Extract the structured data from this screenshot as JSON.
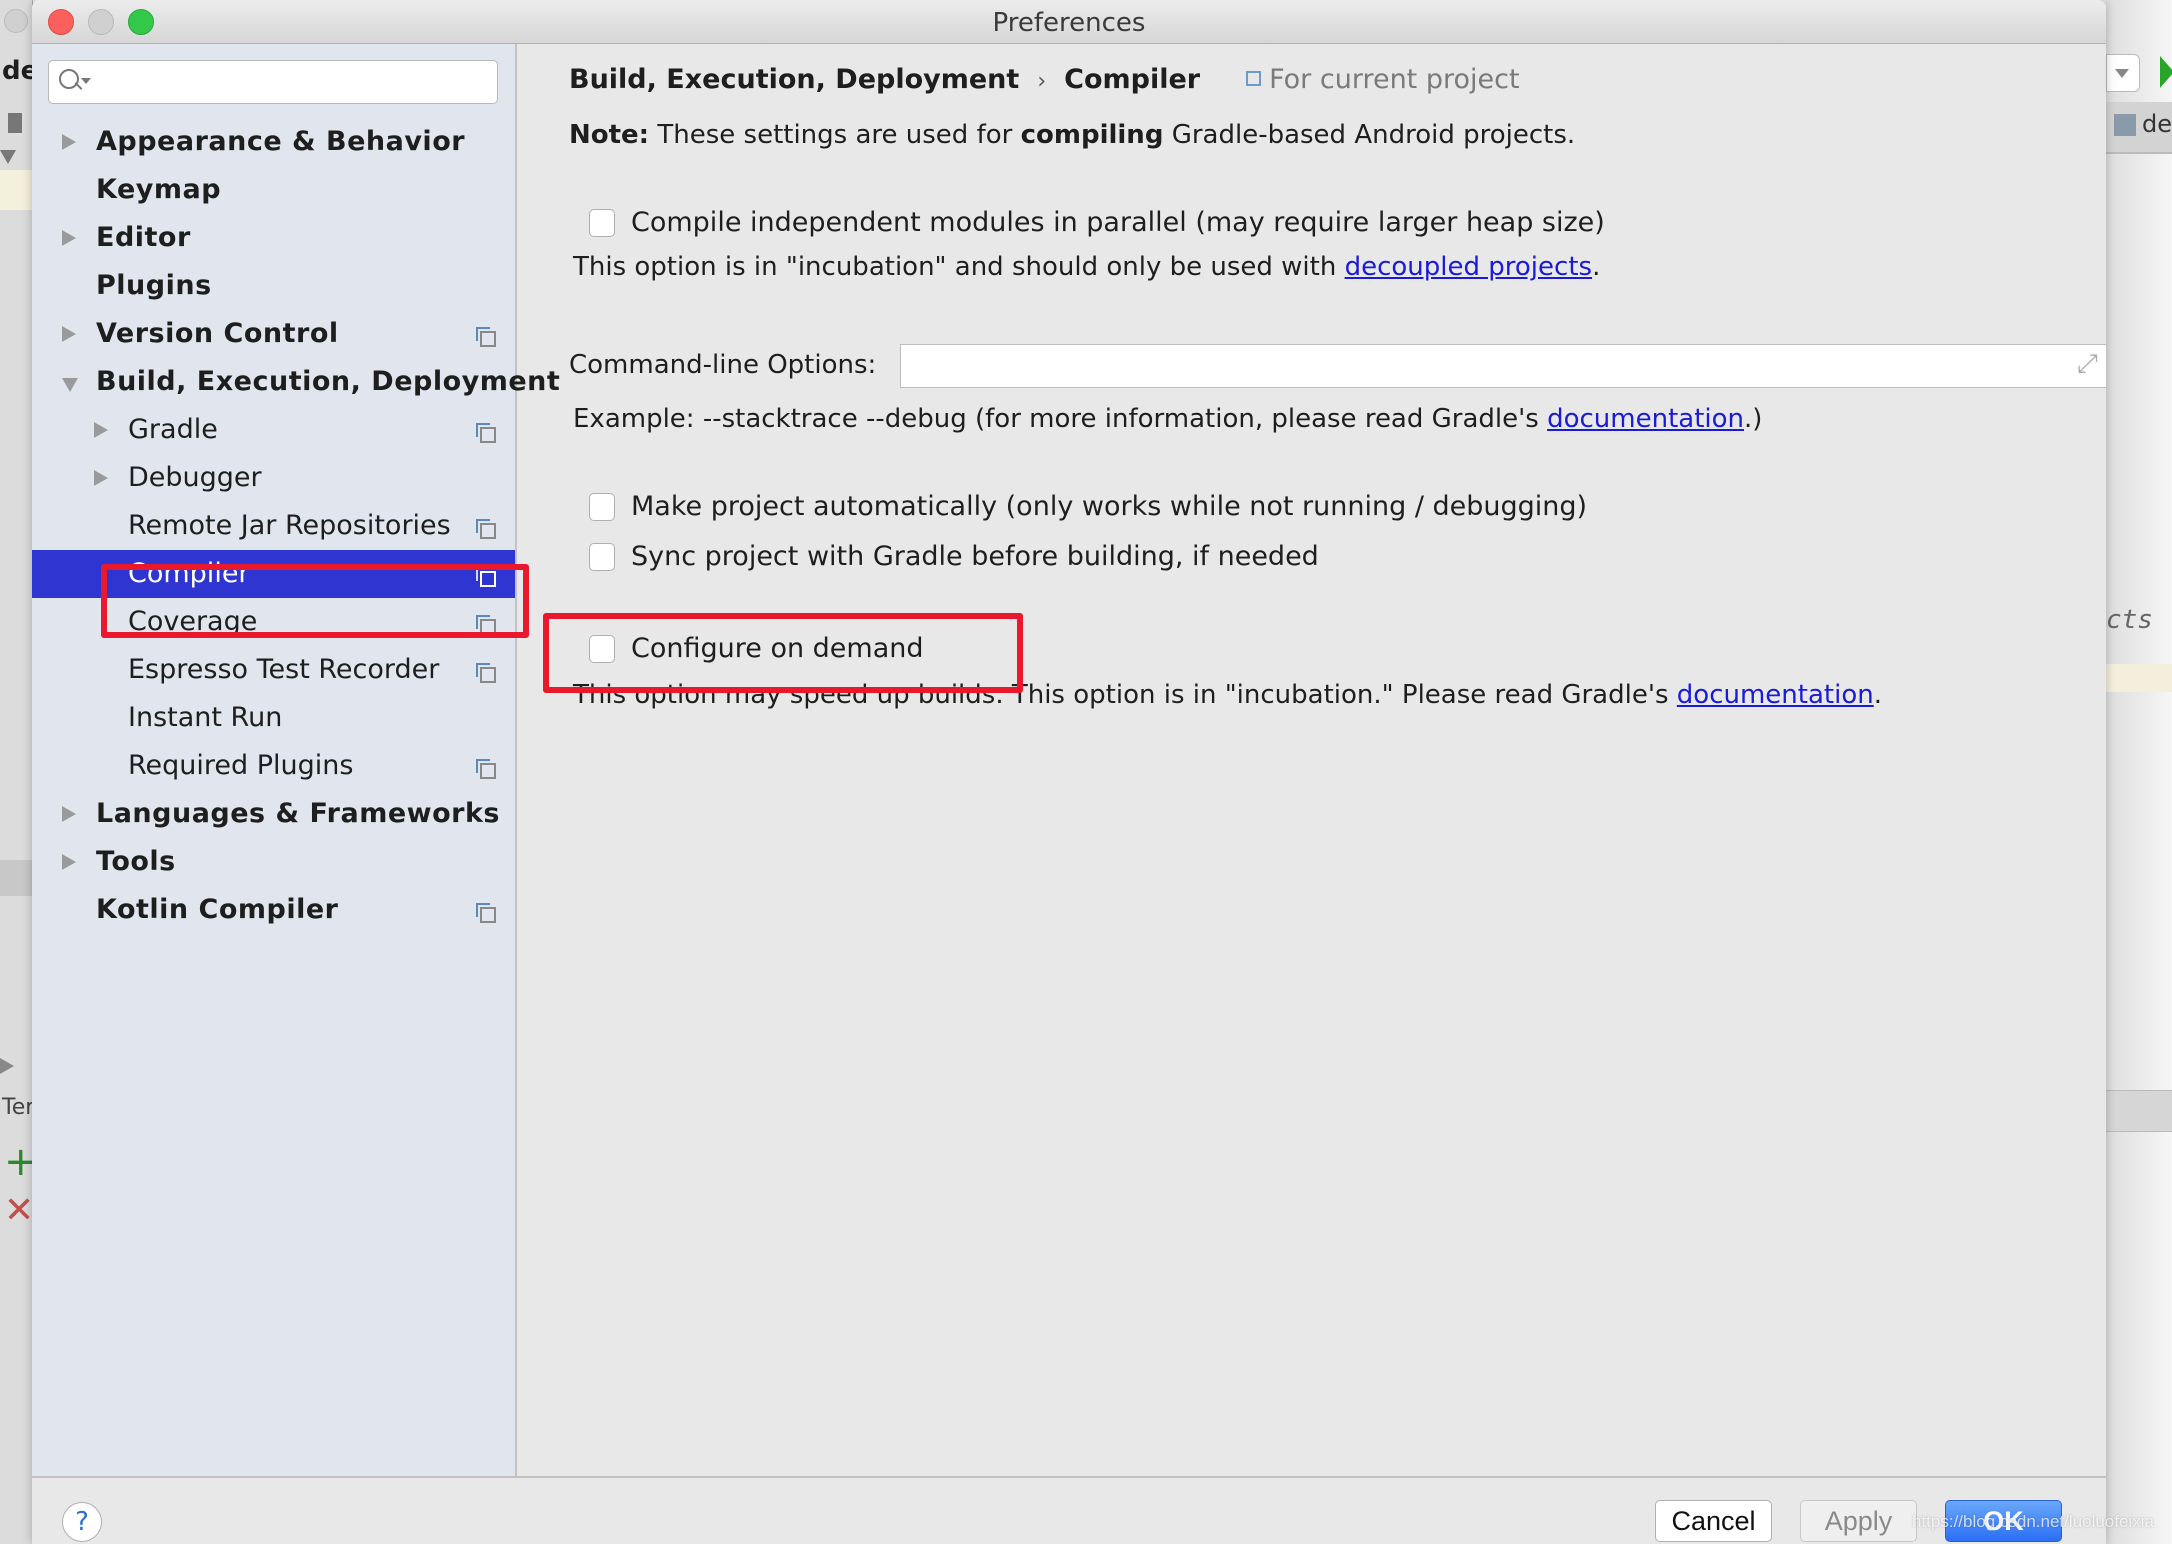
{
  "window": {
    "title": "Preferences"
  },
  "background_ide": {
    "left_partial_label": "de",
    "left_tab_partial": "Ter",
    "right_folder_partial": "de",
    "right_code_partial": "cts"
  },
  "sidebar": {
    "search_placeholder": "",
    "items": [
      {
        "label": "Appearance & Behavior",
        "level": 0,
        "expander": "collapsed",
        "project_icon": false
      },
      {
        "label": "Keymap",
        "level": 0,
        "expander": "none",
        "project_icon": false
      },
      {
        "label": "Editor",
        "level": 0,
        "expander": "collapsed",
        "project_icon": false
      },
      {
        "label": "Plugins",
        "level": 0,
        "expander": "none",
        "project_icon": false
      },
      {
        "label": "Version Control",
        "level": 0,
        "expander": "collapsed",
        "project_icon": true
      },
      {
        "label": "Build, Execution, Deployment",
        "level": 0,
        "expander": "expanded",
        "project_icon": false
      },
      {
        "label": "Gradle",
        "level": 1,
        "expander": "collapsed",
        "project_icon": true
      },
      {
        "label": "Debugger",
        "level": 1,
        "expander": "collapsed",
        "project_icon": false
      },
      {
        "label": "Remote Jar Repositories",
        "level": 1,
        "expander": "none",
        "project_icon": true
      },
      {
        "label": "Compiler",
        "level": 1,
        "expander": "none",
        "project_icon": true,
        "selected": true
      },
      {
        "label": "Coverage",
        "level": 1,
        "expander": "none",
        "project_icon": true
      },
      {
        "label": "Espresso Test Recorder",
        "level": 1,
        "expander": "none",
        "project_icon": true
      },
      {
        "label": "Instant Run",
        "level": 1,
        "expander": "none",
        "project_icon": false
      },
      {
        "label": "Required Plugins",
        "level": 1,
        "expander": "none",
        "project_icon": true
      },
      {
        "label": "Languages & Frameworks",
        "level": 0,
        "expander": "collapsed",
        "project_icon": false
      },
      {
        "label": "Tools",
        "level": 0,
        "expander": "collapsed",
        "project_icon": false
      },
      {
        "label": "Kotlin Compiler",
        "level": 0,
        "expander": "none",
        "project_icon": true
      }
    ]
  },
  "content": {
    "breadcrumb": {
      "parent": "Build, Execution, Deployment",
      "separator": "›",
      "current": "Compiler",
      "scope": "For current project"
    },
    "note": {
      "prefix": "Note:",
      "text_before": " These settings are used for ",
      "bold": "compiling",
      "text_after": " Gradle-based Android projects."
    },
    "parallel": {
      "label": "Compile independent modules in parallel (may require larger heap size)",
      "checked": false,
      "hint_before": "This option is in \"incubation\" and should only be used with ",
      "hint_link": "decoupled projects",
      "hint_after": "."
    },
    "command_line": {
      "label": "Command-line Options:",
      "value": "",
      "example_before": "Example: --stacktrace --debug (for more information, please read Gradle's ",
      "example_link": "documentation",
      "example_after": ".)"
    },
    "make_auto": {
      "label": "Make project automatically (only works while not running / debugging)",
      "checked": false
    },
    "sync_before": {
      "label": "Sync project with Gradle before building, if needed",
      "checked": false
    },
    "configure_on_demand": {
      "label": "Configure on demand",
      "checked": false,
      "hint_before": "This option may speed up builds. This option is in \"incubation.\" Please read Gradle's ",
      "hint_link": "documentation",
      "hint_after": "."
    }
  },
  "footer": {
    "help_label": "?",
    "cancel_label": "Cancel",
    "apply_label": "Apply",
    "ok_label": "OK",
    "apply_enabled": false
  },
  "watermark": "https://blog.csdn.net/luoluofeixia",
  "colors": {
    "selection": "#2f35d0",
    "link": "#1a1ad9",
    "highlight_box": "#e8192c",
    "ok_button": "#2b6ff5"
  }
}
